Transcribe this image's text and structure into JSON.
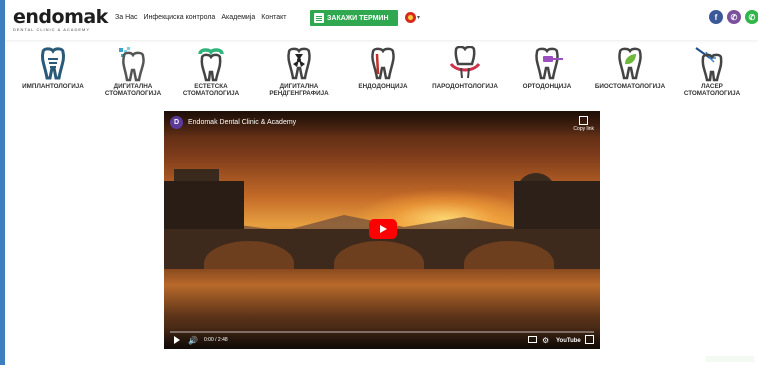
{
  "header": {
    "logo": "endomak",
    "logo_tagline": "DENTAL CLINIC & ACADEMY",
    "nav": [
      {
        "label": "За Нас"
      },
      {
        "label": "Инфекциска контрола"
      },
      {
        "label": "Академија"
      },
      {
        "label": "Контакт"
      }
    ],
    "cta_label": "ЗАКАЖИ ТЕРМИН",
    "language_caret": "▾",
    "social": [
      {
        "name": "facebook",
        "glyph": "f",
        "color": "#3b5998"
      },
      {
        "name": "viber",
        "glyph": "✆",
        "color": "#7b519d"
      },
      {
        "name": "whatsapp",
        "glyph": "✆",
        "color": "#2fb54a"
      }
    ]
  },
  "services": [
    {
      "label": "ИМПЛАНТОЛОГИЈА",
      "icon": "implant-tooth-icon",
      "color": "#2b5a78"
    },
    {
      "label": "ДИГИТАЛНА\nСТОМАТОЛОГИЈА",
      "icon": "digital-tooth-icon",
      "color": "#3aa6c4"
    },
    {
      "label": "ЕСТЕТСКА\nСТОМАТОЛОГИЈА",
      "icon": "aesthetic-tooth-icon",
      "color": "#2fb57a"
    },
    {
      "label": "ДИГИТАЛНА\nРЕНДГЕНГРАФИЈА",
      "icon": "xray-tooth-icon",
      "color": "#333333"
    },
    {
      "label": "ЕНДОДОНЦИЈА",
      "icon": "endodontics-tooth-icon",
      "color": "#c0302a"
    },
    {
      "label": "ПАРОДОНТОЛОГИЈА",
      "icon": "periodontics-tooth-icon",
      "color": "#d0304a"
    },
    {
      "label": "ОРТОДОНЦИЈА",
      "icon": "orthodontics-tooth-icon",
      "color": "#9b4fc0"
    },
    {
      "label": "БИОСТОМАТОЛОГИЈА",
      "icon": "bio-tooth-icon",
      "color": "#6fb83a"
    },
    {
      "label": "ЛАСЕР\nСТОМАТОЛОГИЈА",
      "icon": "laser-tooth-icon",
      "color": "#1e4f8a"
    }
  ],
  "video": {
    "avatar_letter": "D",
    "title": "Endomak Dental Clinic & Academy",
    "copy_link": "Copy link",
    "time": "0:00 / 2:48",
    "brand": "YouTube"
  }
}
